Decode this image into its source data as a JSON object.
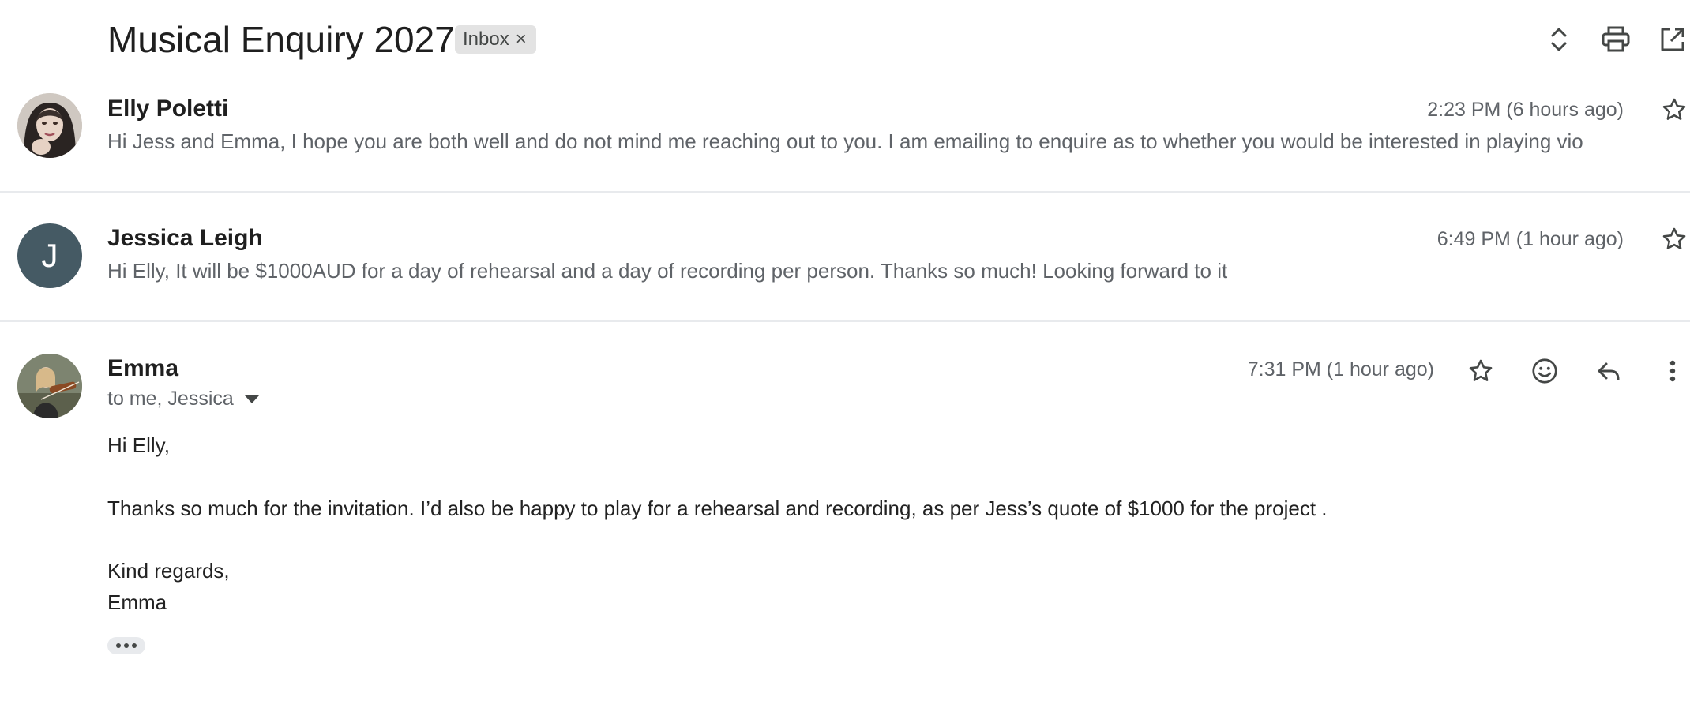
{
  "thread": {
    "subject": "Musical Enquiry 2027",
    "label": "Inbox",
    "label_remove": "×",
    "icons": [
      "expand-collapse-icon",
      "print-icon",
      "open-in-new-window-icon"
    ]
  },
  "messages": [
    {
      "sender": "Elly Poletti",
      "time": "2:23 PM (6 hours ago)",
      "snippet": "Hi Jess and Emma, I hope you are both well and do not mind me reaching out to you. I am emailing to enquire as to whether you would be interested in playing vio",
      "avatar": "photo",
      "starred": false
    },
    {
      "sender": "Jessica Leigh",
      "time": "6:49 PM (1 hour ago)",
      "snippet": "Hi Elly, It will be $1000AUD for a day of rehearsal and a day of recording per person. Thanks so much! Looking forward to it",
      "avatar_initial": "J",
      "avatar_color": "#455a64",
      "starred": false
    },
    {
      "sender": "Emma",
      "time": "7:31 PM (1 hour ago)",
      "recipients": "to me, Jessica",
      "avatar": "photo",
      "starred": false,
      "body": {
        "greeting": "Hi Elly,",
        "paragraph": "Thanks so much for the invitation. I’d also be happy to play for a rehearsal and recording, as per Jess’s quote of $1000 for the project .",
        "signoff": "Kind regards,",
        "signature": "Emma"
      },
      "actions": [
        "star-icon",
        "emoji-react-icon",
        "reply-icon",
        "more-vert-icon"
      ]
    }
  ],
  "colors": {
    "divider": "#e8eaed",
    "chip_bg": "#e3e3e3",
    "muted_text": "#5f6368",
    "avatar_j": "#455a64"
  }
}
